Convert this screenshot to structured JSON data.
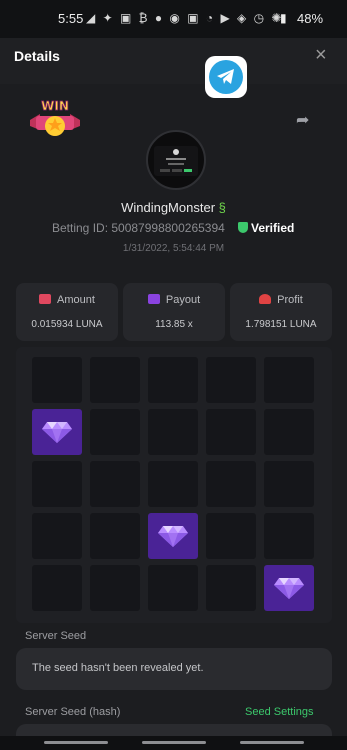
{
  "status_bar": {
    "time": "5:55",
    "notification_icons": "◢ ✦ ▣ ₿ ● ◉ ▣ ◔ ▶ ◈ ◷ ✺",
    "battery": "48%"
  },
  "header": {
    "title": "Details",
    "close_icon": "×"
  },
  "profile": {
    "username": "WindingMonster",
    "betting_id": "Betting ID: 50087998800265394",
    "verified_label": "Verified",
    "date": "1/31/2022, 5:54:44 PM"
  },
  "stats": [
    {
      "label": "Amount",
      "value": "0.015934 LUNA",
      "icon_color": "#e0485f"
    },
    {
      "label": "Payout",
      "value": "113.85 x",
      "icon_color": "#8a43e0"
    },
    {
      "label": "Profit",
      "value": "1.798151 LUNA",
      "icon_color": "#e04343"
    }
  ],
  "grid": {
    "rows": 5,
    "cols": 5,
    "gems": [
      [
        1,
        0
      ],
      [
        3,
        2
      ],
      [
        4,
        4
      ]
    ]
  },
  "seeds": {
    "server_seed_label": "Server Seed",
    "server_seed_text": "The seed hasn't been revealed yet.",
    "server_seed_hash_label": "Server Seed (hash)",
    "seed_settings_link": "Seed Settings"
  },
  "colors": {
    "accent_green": "#3cc86c",
    "gem_purple": "#4a2396",
    "telegram_blue": "#2aa3e0"
  }
}
